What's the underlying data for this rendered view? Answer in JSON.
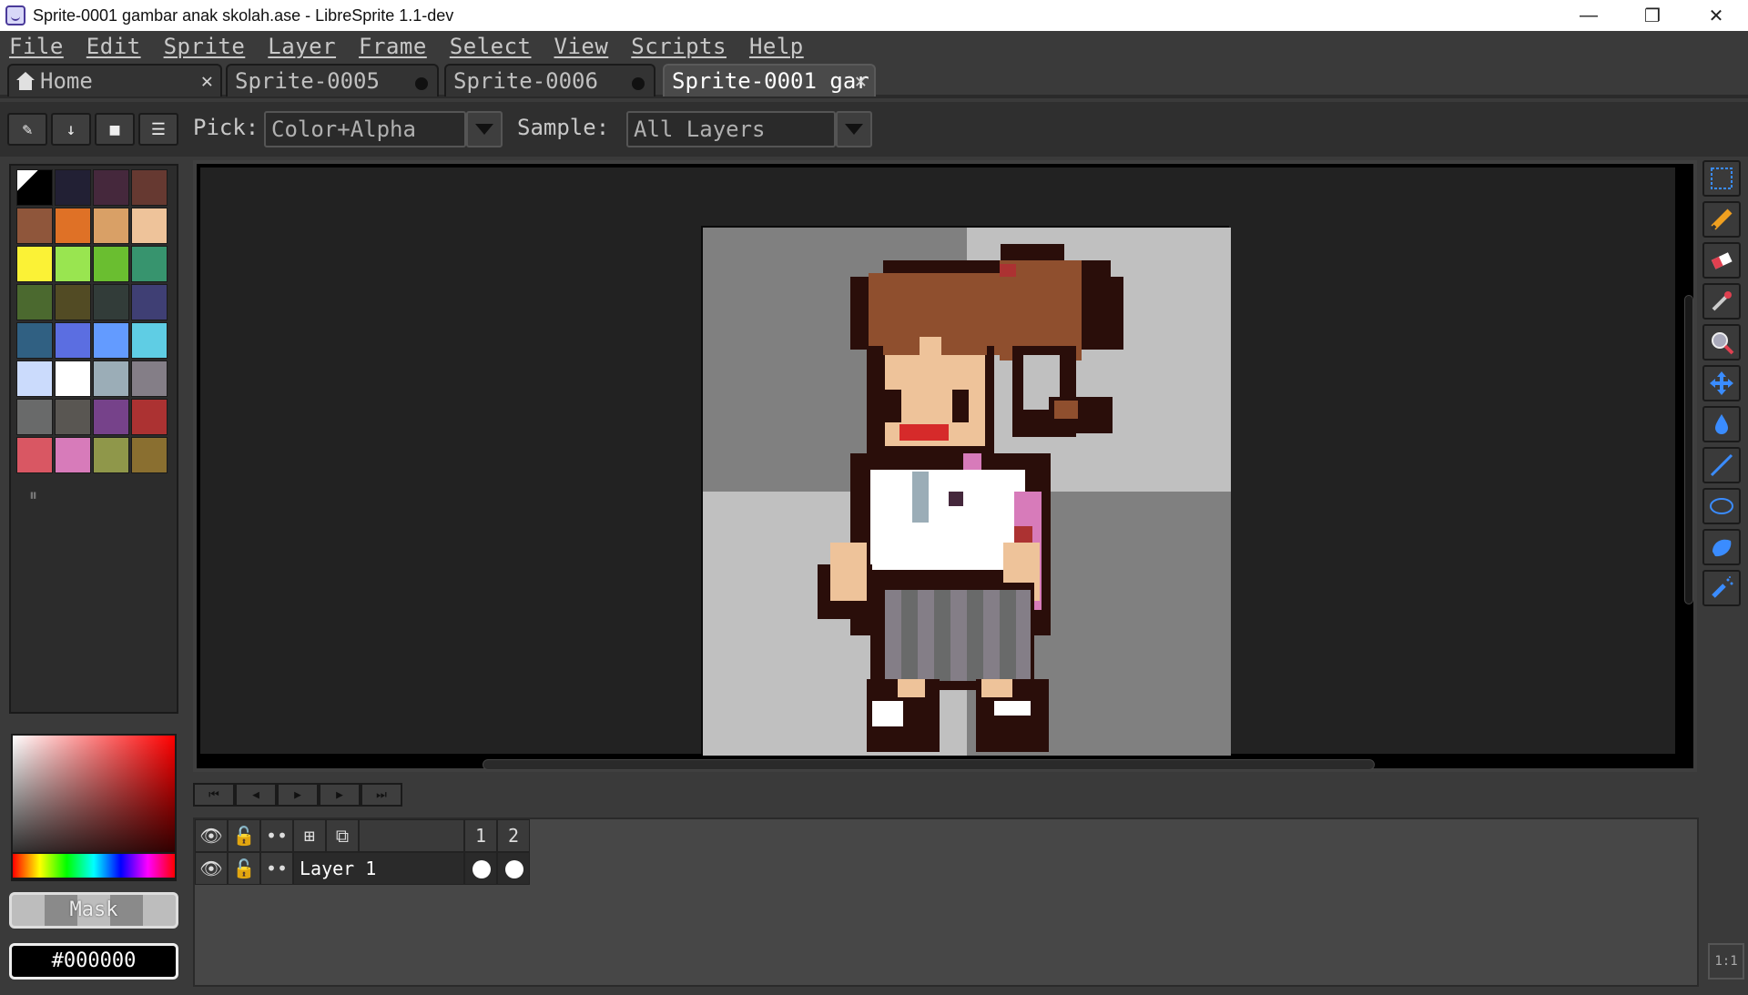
{
  "window": {
    "title": "Sprite-0001 gambar anak skolah.ase - LibreSprite 1.1-dev",
    "minimize": "—",
    "maximize": "❐",
    "close": "✕"
  },
  "menu": [
    "File",
    "Edit",
    "Sprite",
    "Layer",
    "Frame",
    "Select",
    "View",
    "Scripts",
    "Help"
  ],
  "tabs": [
    {
      "label": "Home",
      "icon": "home-icon",
      "state": "close"
    },
    {
      "label": "Sprite-0005",
      "state": "modified"
    },
    {
      "label": "Sprite-0006",
      "state": "modified"
    },
    {
      "label": "Sprite-0001 gar",
      "state": "close",
      "active": true
    }
  ],
  "context": {
    "pick_label": "Pick:",
    "pick_value": "Color+Alpha",
    "sample_label": "Sample:",
    "sample_value": "All Layers"
  },
  "palette": [
    "#000000",
    "#222034",
    "#45283c",
    "#663931",
    "#8f563b",
    "#df7126",
    "#d9a066",
    "#eec39a",
    "#fbf236",
    "#99e550",
    "#6abe30",
    "#37946e",
    "#4b692f",
    "#524b24",
    "#323c39",
    "#3f3f74",
    "#306082",
    "#5b6ee1",
    "#639bff",
    "#5fcde4",
    "#cbdbfc",
    "#ffffff",
    "#9badb7",
    "#847e87",
    "#696a6a",
    "#595652",
    "#76428a",
    "#ac3232",
    "#d95763",
    "#d77bba",
    "#8f974a",
    "#8a6f30"
  ],
  "color": {
    "mask_label": "Mask",
    "hex_value": "#000000"
  },
  "tools": [
    "selection-icon",
    "pencil-icon",
    "eraser-icon",
    "eyedropper-icon",
    "zoom-icon",
    "move-icon",
    "paint-bucket-icon",
    "line-icon",
    "ellipse-icon",
    "contour-icon",
    "spray-icon"
  ],
  "timeline": {
    "frames": [
      "1",
      "2"
    ],
    "layer_name": "Layer 1"
  },
  "zoom_label": "1:1"
}
